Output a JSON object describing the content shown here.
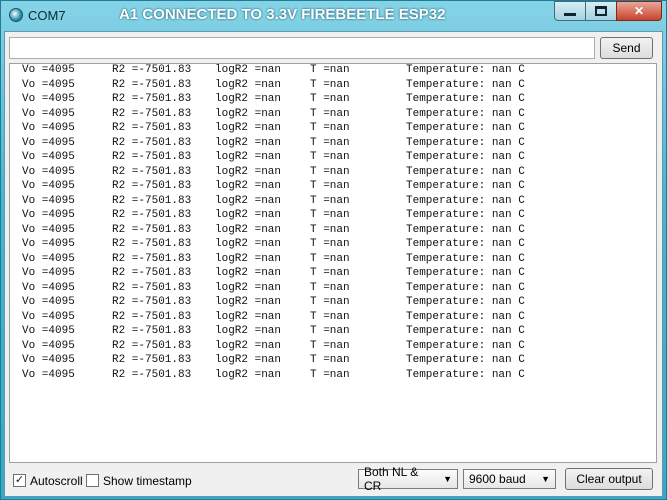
{
  "window": {
    "title": "COM7",
    "caption": "A1 CONNECTED TO 3.3V FIREBEETLE ESP32",
    "icon": "arduino-icon",
    "controls": {
      "minimize": "minimize-icon",
      "maximize": "maximize-icon",
      "close": "close-icon"
    }
  },
  "toolbar": {
    "input_value": "",
    "send_label": "Send"
  },
  "output": {
    "lines": [
      [
        "Vo =4095",
        "R2 =-7501.83",
        "logR2 =nan",
        "T =nan",
        "Temperature: nan C"
      ],
      [
        "Vo =4095",
        "R2 =-7501.83",
        "logR2 =nan",
        "T =nan",
        "Temperature: nan C"
      ],
      [
        "Vo =4095",
        "R2 =-7501.83",
        "logR2 =nan",
        "T =nan",
        "Temperature: nan C"
      ],
      [
        "Vo =4095",
        "R2 =-7501.83",
        "logR2 =nan",
        "T =nan",
        "Temperature: nan C"
      ],
      [
        "Vo =4095",
        "R2 =-7501.83",
        "logR2 =nan",
        "T =nan",
        "Temperature: nan C"
      ],
      [
        "Vo =4095",
        "R2 =-7501.83",
        "logR2 =nan",
        "T =nan",
        "Temperature: nan C"
      ],
      [
        "Vo =4095",
        "R2 =-7501.83",
        "logR2 =nan",
        "T =nan",
        "Temperature: nan C"
      ],
      [
        "Vo =4095",
        "R2 =-7501.83",
        "logR2 =nan",
        "T =nan",
        "Temperature: nan C"
      ],
      [
        "Vo =4095",
        "R2 =-7501.83",
        "logR2 =nan",
        "T =nan",
        "Temperature: nan C"
      ],
      [
        "Vo =4095",
        "R2 =-7501.83",
        "logR2 =nan",
        "T =nan",
        "Temperature: nan C"
      ],
      [
        "Vo =4095",
        "R2 =-7501.83",
        "logR2 =nan",
        "T =nan",
        "Temperature: nan C"
      ],
      [
        "Vo =4095",
        "R2 =-7501.83",
        "logR2 =nan",
        "T =nan",
        "Temperature: nan C"
      ],
      [
        "Vo =4095",
        "R2 =-7501.83",
        "logR2 =nan",
        "T =nan",
        "Temperature: nan C"
      ],
      [
        "Vo =4095",
        "R2 =-7501.83",
        "logR2 =nan",
        "T =nan",
        "Temperature: nan C"
      ],
      [
        "Vo =4095",
        "R2 =-7501.83",
        "logR2 =nan",
        "T =nan",
        "Temperature: nan C"
      ],
      [
        "Vo =4095",
        "R2 =-7501.83",
        "logR2 =nan",
        "T =nan",
        "Temperature: nan C"
      ],
      [
        "Vo =4095",
        "R2 =-7501.83",
        "logR2 =nan",
        "T =nan",
        "Temperature: nan C"
      ],
      [
        "Vo =4095",
        "R2 =-7501.83",
        "logR2 =nan",
        "T =nan",
        "Temperature: nan C"
      ],
      [
        "Vo =4095",
        "R2 =-7501.83",
        "logR2 =nan",
        "T =nan",
        "Temperature: nan C"
      ],
      [
        "Vo =4095",
        "R2 =-7501.83",
        "logR2 =nan",
        "T =nan",
        "Temperature: nan C"
      ],
      [
        "Vo =4095",
        "R2 =-7501.83",
        "logR2 =nan",
        "T =nan",
        "Temperature: nan C"
      ],
      [
        "Vo =4095",
        "R2 =-7501.83",
        "logR2 =nan",
        "T =nan",
        "Temperature: nan C"
      ]
    ]
  },
  "footer": {
    "autoscroll": {
      "label": "Autoscroll",
      "checked": true
    },
    "timestamp": {
      "label": "Show timestamp",
      "checked": false
    },
    "line_ending": "Both NL & CR",
    "baud": "9600 baud",
    "clear_label": "Clear output"
  },
  "colors": {
    "title_bar": "#48b4cf",
    "caption_text": "#ffffff",
    "close_button": "#c8442c"
  }
}
